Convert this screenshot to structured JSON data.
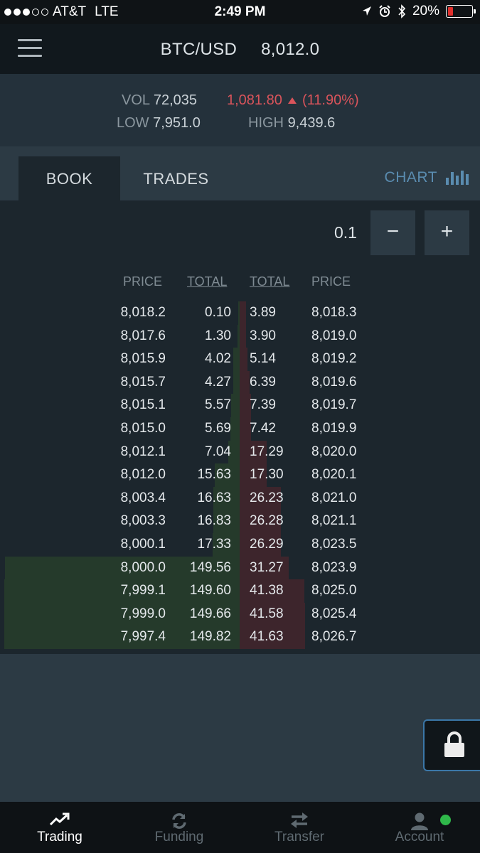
{
  "status_bar": {
    "carrier": "AT&T",
    "network": "LTE",
    "time": "2:49 PM",
    "battery": "20%"
  },
  "header": {
    "pair": "BTC/USD",
    "last_price": "8,012.0"
  },
  "stats": {
    "vol_label": "VOL",
    "vol": "72,035",
    "change": "1,081.80",
    "change_pct": "(11.90%)",
    "low_label": "LOW",
    "low": "7,951.0",
    "high_label": "HIGH",
    "high": "9,439.6"
  },
  "tabs": {
    "book": "BOOK",
    "trades": "TRADES",
    "chart": "CHART"
  },
  "book": {
    "precision": "0.1",
    "minus": "−",
    "plus": "+",
    "headers": {
      "bid_price": "PRICE",
      "bid_total": "TOTAL",
      "ask_total": "TOTAL",
      "ask_price": "PRICE"
    },
    "bids": [
      {
        "price": "8,018.2",
        "total": "0.10"
      },
      {
        "price": "8,017.6",
        "total": "1.30"
      },
      {
        "price": "8,015.9",
        "total": "4.02"
      },
      {
        "price": "8,015.7",
        "total": "4.27"
      },
      {
        "price": "8,015.1",
        "total": "5.57"
      },
      {
        "price": "8,015.0",
        "total": "5.69"
      },
      {
        "price": "8,012.1",
        "total": "7.04"
      },
      {
        "price": "8,012.0",
        "total": "15.63"
      },
      {
        "price": "8,003.4",
        "total": "16.63"
      },
      {
        "price": "8,003.3",
        "total": "16.83"
      },
      {
        "price": "8,000.1",
        "total": "17.33"
      },
      {
        "price": "8,000.0",
        "total": "149.56"
      },
      {
        "price": "7,999.1",
        "total": "149.60"
      },
      {
        "price": "7,999.0",
        "total": "149.66"
      },
      {
        "price": "7,997.4",
        "total": "149.82"
      }
    ],
    "asks": [
      {
        "total": "3.89",
        "price": "8,018.3"
      },
      {
        "total": "3.90",
        "price": "8,019.0"
      },
      {
        "total": "5.14",
        "price": "8,019.2"
      },
      {
        "total": "6.39",
        "price": "8,019.6"
      },
      {
        "total": "7.39",
        "price": "8,019.7"
      },
      {
        "total": "7.42",
        "price": "8,019.9"
      },
      {
        "total": "17.29",
        "price": "8,020.0"
      },
      {
        "total": "17.30",
        "price": "8,020.1"
      },
      {
        "total": "26.23",
        "price": "8,021.0"
      },
      {
        "total": "26.28",
        "price": "8,021.1"
      },
      {
        "total": "26.29",
        "price": "8,023.5"
      },
      {
        "total": "31.27",
        "price": "8,023.9"
      },
      {
        "total": "41.38",
        "price": "8,025.0"
      },
      {
        "total": "41.58",
        "price": "8,025.4"
      },
      {
        "total": "41.63",
        "price": "8,026.7"
      }
    ]
  },
  "nav": {
    "trading": "Trading",
    "funding": "Funding",
    "transfer": "Transfer",
    "account": "Account"
  },
  "colors": {
    "bid_depth": "#253a2b",
    "ask_depth": "#3d252c",
    "change": "#d9545b",
    "chart_link": "#5a8cb0",
    "online": "#2fb84a"
  }
}
